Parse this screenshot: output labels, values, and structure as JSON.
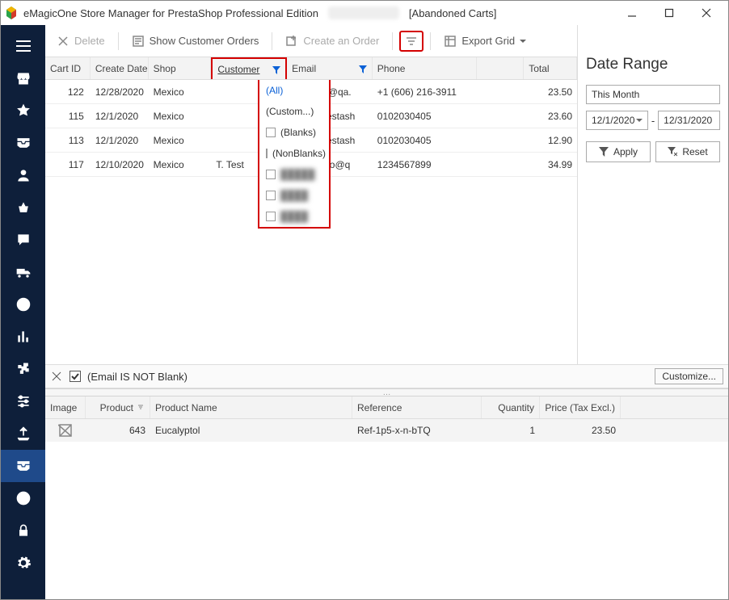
{
  "window": {
    "title_left": "eMagicOne Store Manager for PrestaShop Professional Edition",
    "title_right": "[Abandoned Carts]"
  },
  "toolbar": {
    "delete": "Delete",
    "show_orders": "Show Customer Orders",
    "create_order": "Create an Order",
    "export_grid": "Export Grid"
  },
  "grid": {
    "columns": {
      "cart_id": "Cart ID",
      "create_date": "Create Date",
      "shop": "Shop",
      "customer": "Customer",
      "email": "Email",
      "phone": "Phone",
      "total": "Total"
    },
    "rows": [
      {
        "id": "122",
        "date": "12/28/2020",
        "shop": "Mexico",
        "customer": "",
        "email": "tester-qr@qa.",
        "phone": "+1 (606) 216-3911",
        "total": "23.50"
      },
      {
        "id": "115",
        "date": "12/1/2020",
        "shop": "Mexico",
        "customer": "",
        "email": "pub@prestash",
        "phone": "0102030405",
        "total": "23.60"
      },
      {
        "id": "113",
        "date": "12/1/2020",
        "shop": "Mexico",
        "customer": "",
        "email": "pub@prestash",
        "phone": "0102030405",
        "total": "12.90"
      },
      {
        "id": "117",
        "date": "12/10/2020",
        "shop": "Mexico",
        "customer": "T. Test",
        "email": "alehandro@q",
        "phone": "1234567899",
        "total": "34.99"
      }
    ]
  },
  "customer_filter": {
    "options": [
      {
        "label": "(All)",
        "selected": true
      },
      {
        "label": "(Custom...)"
      },
      {
        "label": "(Blanks)",
        "checkbox": true
      },
      {
        "label": "(NonBlanks)",
        "checkbox": true
      },
      {
        "label": "█████",
        "checkbox": true,
        "blur": true
      },
      {
        "label": "████",
        "checkbox": true,
        "blur": true
      },
      {
        "label": "████",
        "checkbox": true,
        "blur": true
      }
    ]
  },
  "filterbar": {
    "expression": "(Email IS NOT Blank)",
    "customize": "Customize..."
  },
  "detail": {
    "columns": {
      "image": "Image",
      "product": "Product",
      "name": "Product Name",
      "reference": "Reference",
      "quantity": "Quantity",
      "price": "Price (Tax Excl.)"
    },
    "rows": [
      {
        "product": "643",
        "name": "Eucalyptol",
        "reference": "Ref-1p5-x-n-bTQ",
        "quantity": "1",
        "price": "23.50"
      }
    ]
  },
  "date_range": {
    "title": "Date Range",
    "preset": "This Month",
    "from": "12/1/2020",
    "to": "12/31/2020",
    "apply": "Apply",
    "reset": "Reset",
    "dash": "-"
  }
}
